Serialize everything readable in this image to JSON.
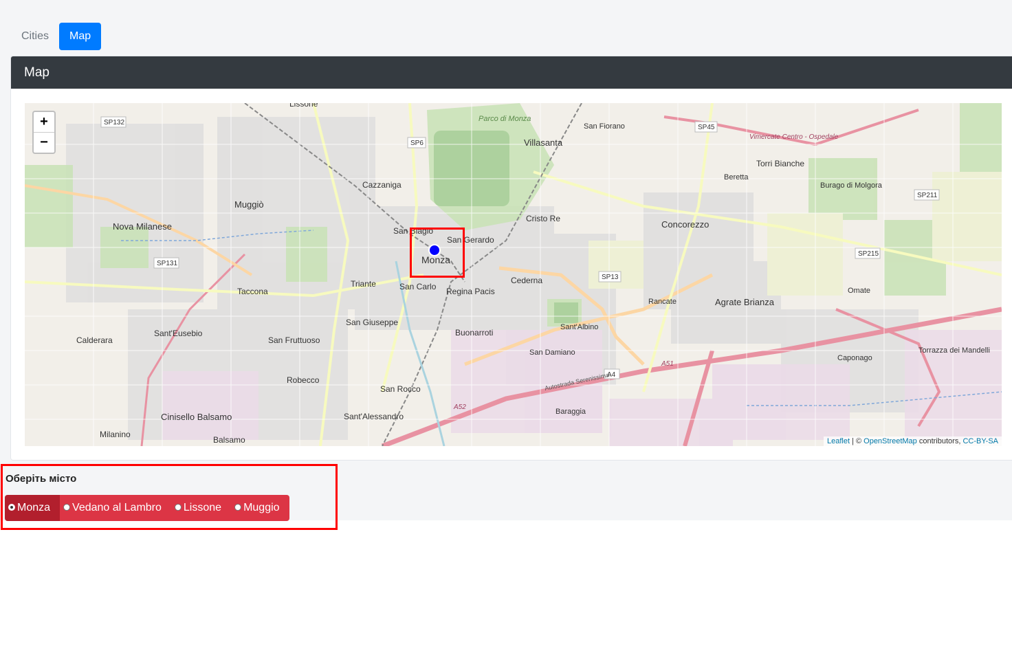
{
  "tabs": [
    {
      "label": "Cities",
      "active": false
    },
    {
      "label": "Map",
      "active": true
    }
  ],
  "card": {
    "title": "Map"
  },
  "map": {
    "zoom_in": "+",
    "zoom_out": "−",
    "attribution": {
      "leaflet": "Leaflet",
      "sep": " | © ",
      "osm": "OpenStreetMap",
      "contrib": " contributors, ",
      "license": "CC-BY-SA"
    },
    "labels": {
      "monza": "Monza",
      "lissone": "Lissone",
      "muggio": "Muggiò",
      "nova": "Nova Milanese",
      "cazzaniga": "Cazzaniga",
      "taccona": "Taccona",
      "triante": "Triante",
      "sancarlo": "San Carlo",
      "sanbiagio": "San Biagio",
      "sangerardo": "San Gerardo",
      "regina": "Regina Pacis",
      "cederna": "Cederna",
      "cristo": "Cristo Re",
      "villasanta": "Villasanta",
      "sanfiorano": "San Fiorano",
      "sangiuseppe": "San Giuseppe",
      "santeusebio": "Sant'Eusebio",
      "calderara": "Calderara",
      "sanfruttuoso": "San Fruttuoso",
      "buonarroti": "Buonarroti",
      "santalbino": "Sant'Albino",
      "sandamiano": "San Damiano",
      "concorezzo": "Concorezzo",
      "rancate": "Rancate",
      "agrate": "Agrate Brianza",
      "omate": "Omate",
      "caponago": "Caponago",
      "torri": "Torri Bianche",
      "beretta": "Beretta",
      "burago": "Burago di Molgora",
      "baraggia": "Baraggia",
      "robecco": "Robecco",
      "sanrocco": "San Rocco",
      "santalessandro": "Sant'Alessandro",
      "cinisello": "Cinisello Balsamo",
      "milanino": "Milanino",
      "balsamo": "Balsamo",
      "parco": "Parco di Monza",
      "sp132": "SP132",
      "sp131": "SP131",
      "sp6": "SP6",
      "sp45": "SP45",
      "sp13": "SP13",
      "sp211": "SP211",
      "sp215": "SP215",
      "a4": "A4",
      "a51": "A51",
      "a52": "A52",
      "torrazza": "Torrazza dei Mandelli",
      "autostrada": "Autostrada Serenissima",
      "vimercate": "Vimercate Centro - Ospedale"
    }
  },
  "city_selector": {
    "title": "Оберіть місто",
    "options": [
      {
        "label": "Monza",
        "selected": true
      },
      {
        "label": "Vedano al Lambro",
        "selected": false
      },
      {
        "label": "Lissone",
        "selected": false
      },
      {
        "label": "Muggio",
        "selected": false
      }
    ]
  },
  "colors": {
    "primary": "#007bff",
    "danger": "#dc3545",
    "dark": "#343a40",
    "highlight": "#ff0000",
    "marker": "#0000ff"
  }
}
